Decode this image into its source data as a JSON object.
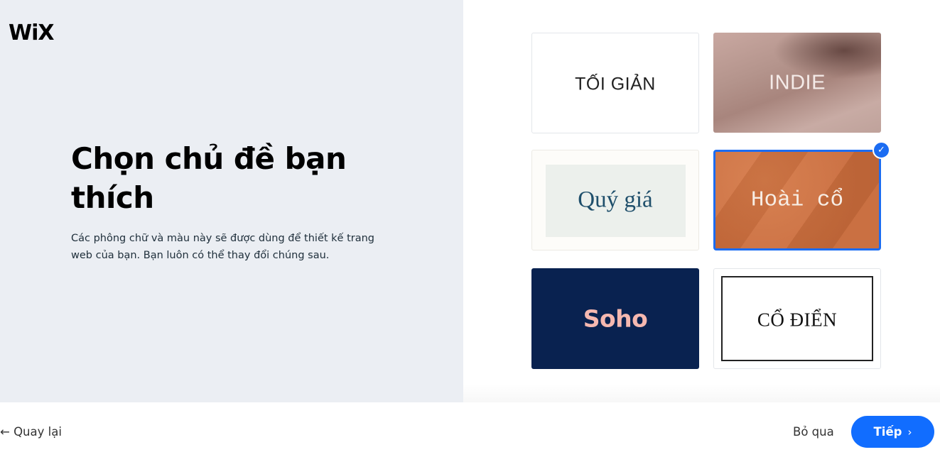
{
  "brand": {
    "logo_text": "WiX"
  },
  "intro": {
    "title": "Chọn chủ đề bạn thích",
    "description": "Các phông chữ và màu này sẽ được dùng để thiết kế trang web của bạn. Bạn luôn có thể thay đổi chúng sau."
  },
  "themes": [
    {
      "label": "TỐI GIẢN",
      "selected": false
    },
    {
      "label": "INDIE",
      "selected": false
    },
    {
      "label": "Quý giá",
      "selected": false
    },
    {
      "label": "Hoài cổ",
      "selected": true
    },
    {
      "label": "Soho",
      "selected": false
    },
    {
      "label": "CỔ ĐIỂN",
      "selected": false
    }
  ],
  "selection_mark": "✓",
  "footer": {
    "back_label": "← Quay lại",
    "skip_label": "Bỏ qua",
    "next_label": "Tiếp",
    "next_chevron": "›"
  },
  "colors": {
    "accent": "#116dff",
    "left_panel_bg": "#ebeef3",
    "soho_bg": "#092250",
    "soho_text": "#f5b8b0",
    "hoaico_bg": "#c86a3a",
    "quygia_text": "#1f4f6b"
  }
}
